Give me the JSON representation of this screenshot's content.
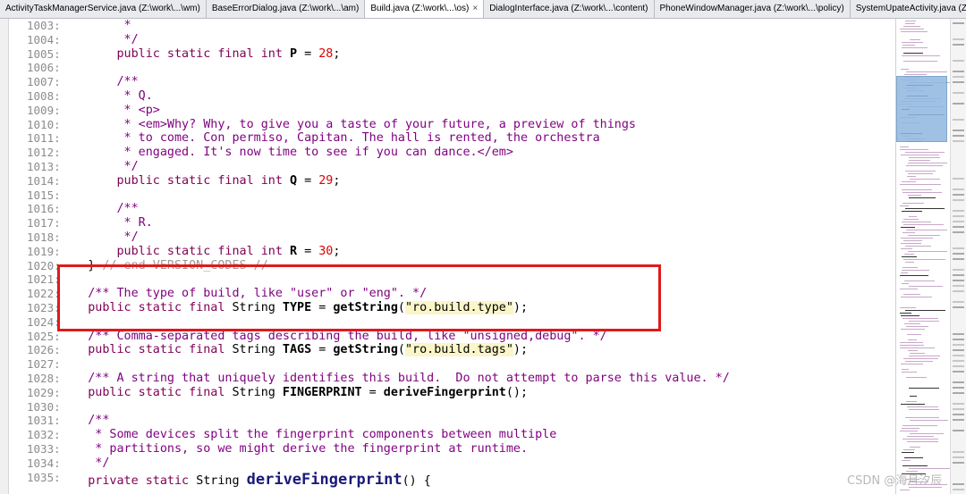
{
  "tabs": [
    {
      "label": "ActivityTaskManagerService.java (Z:\\work\\...\\wm)",
      "active": false
    },
    {
      "label": "BaseErrorDialog.java (Z:\\work\\...\\am)",
      "active": false
    },
    {
      "label": "Build.java (Z:\\work\\...\\os)",
      "active": true,
      "close": "×"
    },
    {
      "label": "DialogInterface.java (Z:\\work\\...\\content)",
      "active": false
    },
    {
      "label": "PhoneWindowManager.java (Z:\\work\\...\\policy)",
      "active": false
    },
    {
      "label": "SystemUpateActivity.java (Z:\\work\\...",
      "active": false
    }
  ],
  "line_numbers": [
    "1003:",
    "1004:",
    "1005:",
    "1006:",
    "1007:",
    "1008:",
    "1009:",
    "1010:",
    "1011:",
    "1012:",
    "1013:",
    "1014:",
    "1015:",
    "1016:",
    "1017:",
    "1018:",
    "1019:",
    "1020:",
    "1021:",
    "1022:",
    "1023:",
    "1024:",
    "1025:",
    "1026:",
    "1027:",
    "1028:",
    "1029:",
    "1030:",
    "1031:",
    "1032:",
    "1033:",
    "1034:",
    "1035:"
  ],
  "code": {
    "l1003": "         *",
    "l1004": "         */",
    "l1005_a": "        public static final int ",
    "l1005_b": "P",
    "l1005_c": " = ",
    "l1005_d": "28",
    "l1005_e": ";",
    "l1007": "        /**",
    "l1008": "         * Q.",
    "l1009": "         * <p>",
    "l1010": "         * <em>Why? Why, to give you a taste of your future, a preview of things",
    "l1011": "         * to come. Con permiso, Capitan. The hall is rented, the orchestra",
    "l1012": "         * engaged. It's now time to see if you can dance.</em>",
    "l1013": "         */",
    "l1014_a": "        public static final int ",
    "l1014_b": "Q",
    "l1014_c": " = ",
    "l1014_d": "29",
    "l1014_e": ";",
    "l1016": "        /**",
    "l1017": "         * R.",
    "l1018": "         */",
    "l1019_a": "        public static final int ",
    "l1019_b": "R",
    "l1019_c": " = ",
    "l1019_d": "30",
    "l1019_e": ";",
    "l1020_a": "    } ",
    "l1020_b": "// end VERSION_CODES //",
    "l1022": "    /** The type of build, like \"user\" or \"eng\". */",
    "l1023_a": "    public static final ",
    "l1023_b": "String ",
    "l1023_c": "TYPE",
    "l1023_d": " = ",
    "l1023_e": "getString",
    "l1023_f": "(",
    "l1023_g": "\"ro.build.type\"",
    "l1023_h": ");",
    "l1025": "    /** Comma-separated tags describing the build, like \"unsigned,debug\". */",
    "l1026_a": "    public static final ",
    "l1026_b": "String ",
    "l1026_c": "TAGS",
    "l1026_d": " = ",
    "l1026_e": "getString",
    "l1026_f": "(",
    "l1026_g": "\"ro.build.tags\"",
    "l1026_h": ");",
    "l1028": "    /** A string that uniquely identifies this build.  Do not attempt to parse this value. */",
    "l1029_a": "    public static final ",
    "l1029_b": "String ",
    "l1029_c": "FINGERPRINT",
    "l1029_d": " = ",
    "l1029_e": "deriveFingerprint",
    "l1029_f": "();",
    "l1031": "    /**",
    "l1032": "     * Some devices split the fingerprint components between multiple",
    "l1033": "     * partitions, so we might derive the fingerprint at runtime.",
    "l1034": "     */",
    "l1035_a": "    private static ",
    "l1035_b": "String ",
    "l1035_c": "deriveFingerprint",
    "l1035_d": "() {"
  },
  "watermark": "CSDN @海月汐辰"
}
